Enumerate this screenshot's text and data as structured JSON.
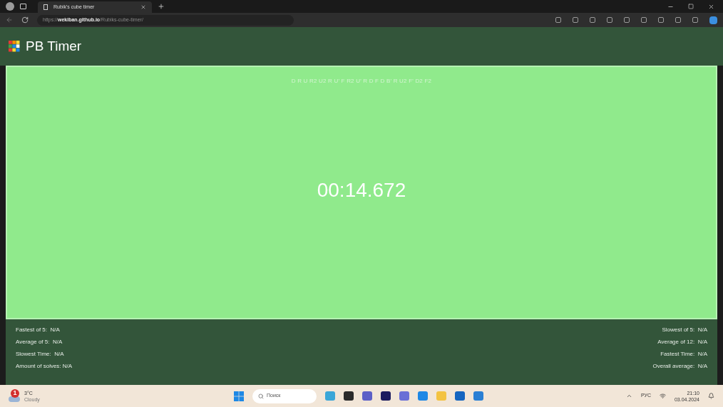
{
  "browser": {
    "tab_title": "Rubik's cube timer",
    "url_prefix": "https://",
    "url_host": "wekiban.github.io",
    "url_path": "/Rubiks-cube-timer/"
  },
  "app": {
    "title": "PB Timer",
    "scramble": "D R U R2 U2 R U' F R2 U' R D F D B' R U2 F' D2 F2",
    "time": "00:14.672"
  },
  "stats_left": [
    "Fastest of 5:  N/A",
    "Average of 5:  N/A",
    "Slowest Time:  N/A",
    "Amount of solves: N/A"
  ],
  "stats_right": [
    "Slowest of 5:  N/A",
    "Average of 12:  N/A",
    "Fastest Time:  N/A",
    "Overall average:  N/A"
  ],
  "taskbar": {
    "weather_temp": "3°C",
    "weather_text": "Cloudy",
    "weather_badge": "1",
    "search_placeholder": "Поиск",
    "language": "РУС",
    "time": "21:10",
    "date": "03.04.2024"
  }
}
